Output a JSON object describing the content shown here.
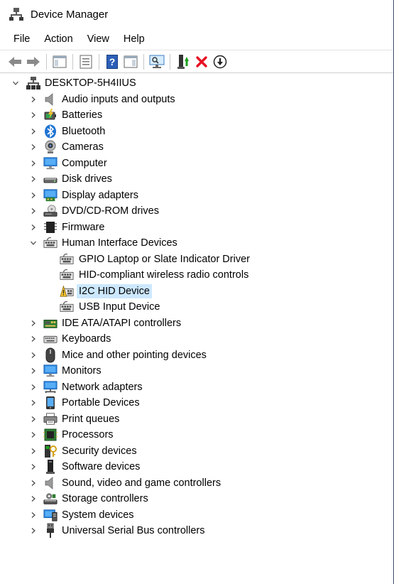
{
  "window": {
    "title": "Device Manager"
  },
  "menu": [
    "File",
    "Action",
    "View",
    "Help"
  ],
  "toolbar": {
    "buttons": [
      {
        "icon": "back-arrow-icon"
      },
      {
        "icon": "forward-arrow-icon"
      },
      {
        "icon": "show-hide-console-tree-icon"
      },
      {
        "icon": "properties-icon"
      },
      {
        "icon": "help-icon"
      },
      {
        "icon": "action-pane-icon"
      },
      {
        "icon": "scan-hardware-changes-icon"
      },
      {
        "icon": "update-driver-icon"
      },
      {
        "icon": "uninstall-device-icon"
      },
      {
        "icon": "disable-device-icon"
      }
    ]
  },
  "tree": {
    "root": {
      "label": "DESKTOP-5H4IIUS",
      "expanded": true,
      "icon": "computer-tree-root-icon"
    },
    "categories": [
      {
        "label": "Audio inputs and outputs",
        "icon": "speaker-icon"
      },
      {
        "label": "Batteries",
        "icon": "battery-icon"
      },
      {
        "label": "Bluetooth",
        "icon": "bluetooth-icon"
      },
      {
        "label": "Cameras",
        "icon": "webcam-icon"
      },
      {
        "label": "Computer",
        "icon": "monitor-icon"
      },
      {
        "label": "Disk drives",
        "icon": "disk-drive-icon"
      },
      {
        "label": "Display adapters",
        "icon": "display-adapter-icon"
      },
      {
        "label": "DVD/CD-ROM drives",
        "icon": "dvd-drive-icon"
      },
      {
        "label": "Firmware",
        "icon": "firmware-chip-icon"
      },
      {
        "label": "Human Interface Devices",
        "icon": "hid-icon",
        "expanded": true,
        "children": [
          {
            "label": "GPIO Laptop or Slate Indicator Driver",
            "icon": "hid-icon"
          },
          {
            "label": "HID-compliant wireless radio controls",
            "icon": "hid-icon"
          },
          {
            "label": "I2C HID Device",
            "icon": "hid-warning-icon",
            "selected": true
          },
          {
            "label": "USB Input Device",
            "icon": "hid-icon"
          }
        ]
      },
      {
        "label": "IDE ATA/ATAPI controllers",
        "icon": "ide-controller-icon"
      },
      {
        "label": "Keyboards",
        "icon": "keyboard-icon"
      },
      {
        "label": "Mice and other pointing devices",
        "icon": "mouse-icon"
      },
      {
        "label": "Monitors",
        "icon": "monitor-icon"
      },
      {
        "label": "Network adapters",
        "icon": "network-adapter-icon"
      },
      {
        "label": "Portable Devices",
        "icon": "portable-device-icon"
      },
      {
        "label": "Print queues",
        "icon": "printer-icon"
      },
      {
        "label": "Processors",
        "icon": "processor-icon"
      },
      {
        "label": "Security devices",
        "icon": "security-device-icon"
      },
      {
        "label": "Software devices",
        "icon": "software-device-icon"
      },
      {
        "label": "Sound, video and game controllers",
        "icon": "speaker-icon"
      },
      {
        "label": "Storage controllers",
        "icon": "storage-controller-icon"
      },
      {
        "label": "System devices",
        "icon": "system-device-icon"
      },
      {
        "label": "Universal Serial Bus controllers",
        "icon": "usb-icon"
      }
    ]
  },
  "colors": {
    "selection": "#cce8ff",
    "accent": "#1e73d2",
    "error_red": "#e81123",
    "warning": "#f4c430"
  }
}
